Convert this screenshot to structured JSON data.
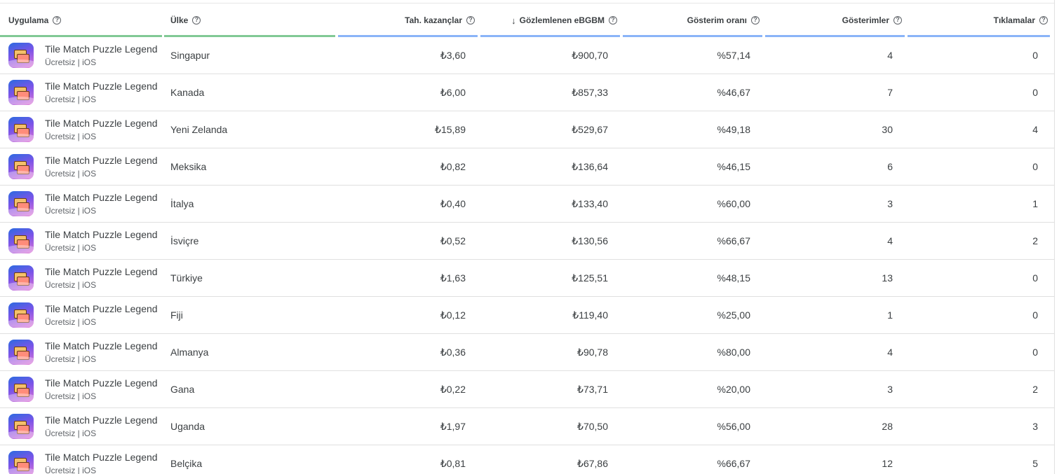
{
  "colors": {
    "bar_green": "#81c995",
    "bar_blue": "#8ab4f8",
    "text": "#3c4043",
    "muted": "#5f6368",
    "divider": "#e0e0e0"
  },
  "headers": {
    "app": "Uygulama",
    "country": "Ülke",
    "earnings": "Tah. kazançlar",
    "ecpm": "Gözlemlenen eBGBM",
    "rate": "Gösterim oranı",
    "impressions": "Gösterimler",
    "clicks": "Tıklamalar",
    "help_glyph": "?",
    "sort_glyph": "↓"
  },
  "rows": [
    {
      "app": "Tile Match Puzzle Legend",
      "meta": "Ücretsiz | iOS",
      "country": "Singapur",
      "earnings": "₺3,60",
      "ecpm": "₺900,70",
      "rate": "%57,14",
      "impressions": "4",
      "clicks": "0"
    },
    {
      "app": "Tile Match Puzzle Legend",
      "meta": "Ücretsiz | iOS",
      "country": "Kanada",
      "earnings": "₺6,00",
      "ecpm": "₺857,33",
      "rate": "%46,67",
      "impressions": "7",
      "clicks": "0"
    },
    {
      "app": "Tile Match Puzzle Legend",
      "meta": "Ücretsiz | iOS",
      "country": "Yeni Zelanda",
      "earnings": "₺15,89",
      "ecpm": "₺529,67",
      "rate": "%49,18",
      "impressions": "30",
      "clicks": "4"
    },
    {
      "app": "Tile Match Puzzle Legend",
      "meta": "Ücretsiz | iOS",
      "country": "Meksika",
      "earnings": "₺0,82",
      "ecpm": "₺136,64",
      "rate": "%46,15",
      "impressions": "6",
      "clicks": "0"
    },
    {
      "app": "Tile Match Puzzle Legend",
      "meta": "Ücretsiz | iOS",
      "country": "İtalya",
      "earnings": "₺0,40",
      "ecpm": "₺133,40",
      "rate": "%60,00",
      "impressions": "3",
      "clicks": "1"
    },
    {
      "app": "Tile Match Puzzle Legend",
      "meta": "Ücretsiz | iOS",
      "country": "İsviçre",
      "earnings": "₺0,52",
      "ecpm": "₺130,56",
      "rate": "%66,67",
      "impressions": "4",
      "clicks": "2"
    },
    {
      "app": "Tile Match Puzzle Legend",
      "meta": "Ücretsiz | iOS",
      "country": "Türkiye",
      "earnings": "₺1,63",
      "ecpm": "₺125,51",
      "rate": "%48,15",
      "impressions": "13",
      "clicks": "0"
    },
    {
      "app": "Tile Match Puzzle Legend",
      "meta": "Ücretsiz | iOS",
      "country": "Fiji",
      "earnings": "₺0,12",
      "ecpm": "₺119,40",
      "rate": "%25,00",
      "impressions": "1",
      "clicks": "0"
    },
    {
      "app": "Tile Match Puzzle Legend",
      "meta": "Ücretsiz | iOS",
      "country": "Almanya",
      "earnings": "₺0,36",
      "ecpm": "₺90,78",
      "rate": "%80,00",
      "impressions": "4",
      "clicks": "0"
    },
    {
      "app": "Tile Match Puzzle Legend",
      "meta": "Ücretsiz | iOS",
      "country": "Gana",
      "earnings": "₺0,22",
      "ecpm": "₺73,71",
      "rate": "%20,00",
      "impressions": "3",
      "clicks": "2"
    },
    {
      "app": "Tile Match Puzzle Legend",
      "meta": "Ücretsiz | iOS",
      "country": "Uganda",
      "earnings": "₺1,97",
      "ecpm": "₺70,50",
      "rate": "%56,00",
      "impressions": "28",
      "clicks": "3"
    },
    {
      "app": "Tile Match Puzzle Legend",
      "meta": "Ücretsiz | iOS",
      "country": "Belçika",
      "earnings": "₺0,81",
      "ecpm": "₺67,86",
      "rate": "%66,67",
      "impressions": "12",
      "clicks": "5"
    }
  ]
}
